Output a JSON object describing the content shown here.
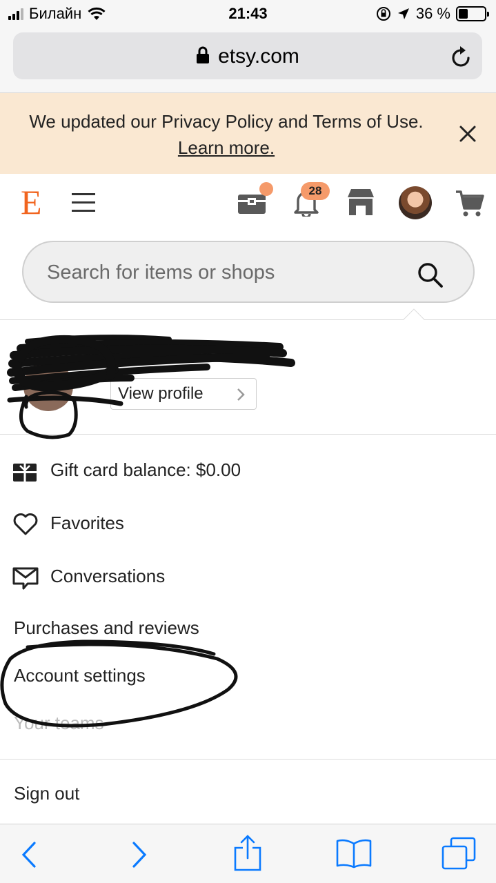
{
  "status_bar": {
    "carrier": "Билайн",
    "time": "21:43",
    "battery": "36 %",
    "battery_level": 0.36
  },
  "browser": {
    "url": "etsy.com"
  },
  "banner": {
    "message": "We updated our Privacy Policy and Terms of Use.",
    "link": "Learn more."
  },
  "header": {
    "logo": "E",
    "notification_count": "28"
  },
  "search": {
    "placeholder": "Search for items or shops"
  },
  "profile": {
    "view_profile_label": "View profile"
  },
  "menu": {
    "gift_card": "Gift card balance: $0.00",
    "favorites": "Favorites",
    "conversations": "Conversations",
    "purchases": "Purchases and reviews",
    "account_settings": "Account settings",
    "your_teams": "Your teams",
    "sign_out": "Sign out"
  },
  "colors": {
    "accent": "#f1641e",
    "banner_bg": "#fae8d2",
    "ios_blue": "#0a7aff"
  }
}
